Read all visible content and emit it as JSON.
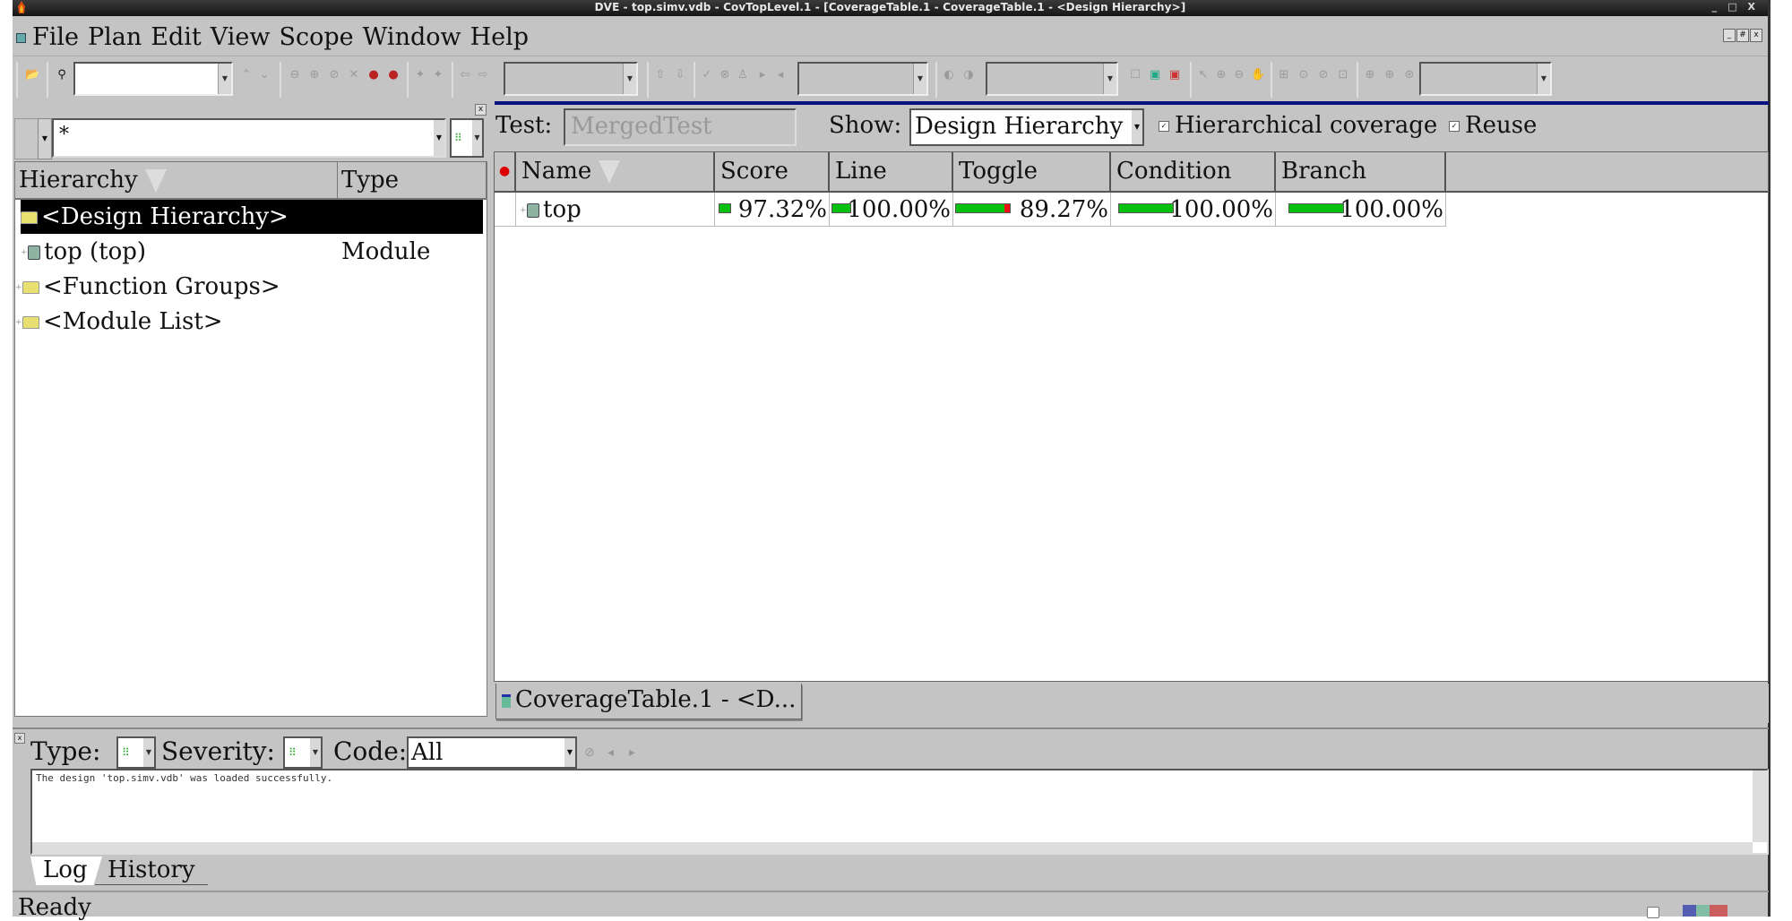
{
  "window": {
    "title": "DVE - top.simv.vdb -  CovTopLevel.1 - [CoverageTable.1 - CoverageTable.1 - <Design Hierarchy>]",
    "controls": [
      "_",
      "□",
      "X"
    ]
  },
  "menubar": {
    "items": [
      "File",
      "Plan",
      "Edit",
      "View",
      "Scope",
      "Window",
      "Help"
    ],
    "mdi_controls": [
      "_",
      "#",
      "x"
    ]
  },
  "toolbar": {
    "search_value": "",
    "combo1_value": "",
    "combo2_value": "",
    "combo3_value": "",
    "combo4_value": ""
  },
  "left_pane": {
    "filter_value": "*",
    "type_filter_glyph": "⠿",
    "columns": [
      "Hierarchy",
      "Type"
    ],
    "rows": [
      {
        "name": "<Design Hierarchy>",
        "type": "",
        "icon": "folder-icon",
        "selected": true
      },
      {
        "name": "top (top)",
        "type": "Module",
        "icon": "module-icon",
        "selected": false
      },
      {
        "name": "<Function Groups>",
        "type": "",
        "icon": "folder-icon",
        "selected": false
      },
      {
        "name": "<Module List>",
        "type": "",
        "icon": "folder-icon",
        "selected": false
      }
    ]
  },
  "right_pane": {
    "test_label": "Test:",
    "test_value": "MergedTest",
    "show_label": "Show:",
    "show_value": "Design Hierarchy",
    "hier_coverage_label": "Hierarchical coverage",
    "hier_coverage_checked": true,
    "reuse_label": "Reuse",
    "reuse_checked": true,
    "columns": [
      "Name",
      "Score",
      "Line",
      "Toggle",
      "Condition",
      "Branch"
    ],
    "rows": [
      {
        "name": "top",
        "score": {
          "text": "97.32%",
          "value": 97.32
        },
        "line": {
          "text": "100.00%",
          "value": 100.0
        },
        "toggle": {
          "text": "89.27%",
          "value": 89.27
        },
        "condition": {
          "text": "100.00%",
          "value": 100.0
        },
        "branch": {
          "text": "100.00%",
          "value": 100.0
        }
      }
    ],
    "bar_colors": {
      "covered": "#08c010",
      "uncovered": "#ee1111"
    },
    "doc_tab_label": "CoverageTable.1 - <D..."
  },
  "console": {
    "type_label": "Type:",
    "severity_label": "Severity:",
    "code_label": "Code:",
    "code_value": "All",
    "log_message": "The design 'top.simv.vdb' was loaded successfully.",
    "tabs": [
      "Log",
      "History"
    ],
    "active_tab": "Log"
  },
  "status": {
    "text": "Ready"
  },
  "accent_color": "#0a1480"
}
